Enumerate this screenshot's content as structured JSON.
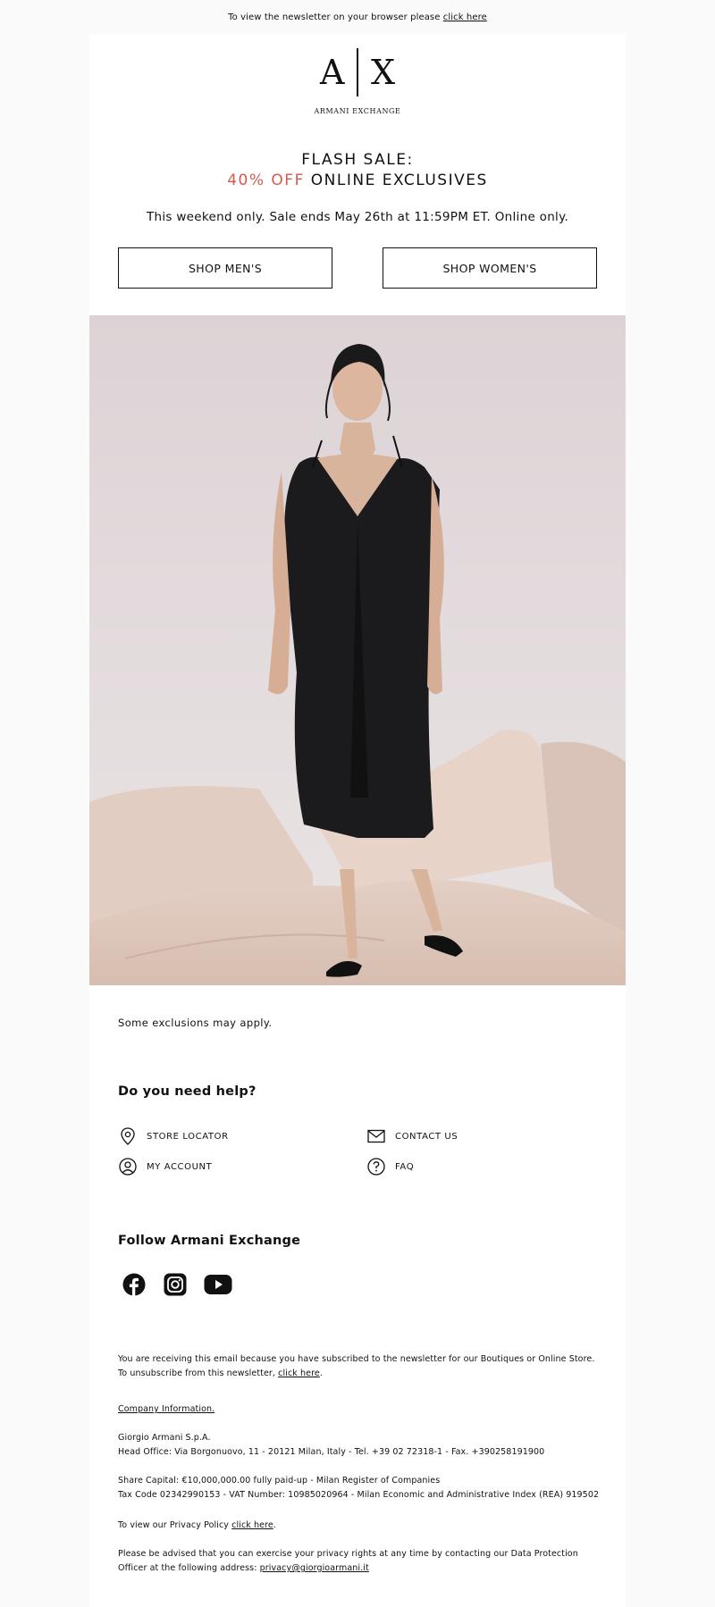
{
  "topbar": {
    "text": "To view the newsletter on your browser please ",
    "link": "click here"
  },
  "logo": {
    "left_letter": "A",
    "right_letter": "X",
    "name": "ARMANI EXCHANGE"
  },
  "headline": {
    "line1": "FLASH SALE:",
    "highlight": "40% OFF",
    "line2_rest": " ONLINE EXCLUSIVES"
  },
  "subline": "This weekend only. Sale ends May 26th at 11:59PM ET. Online only.",
  "buttons": {
    "men": "SHOP MEN'S",
    "women": "SHOP WOMEN'S"
  },
  "exclusions": "Some exclusions may apply.",
  "help": {
    "title": "Do you need help?",
    "items": [
      {
        "label": "STORE LOCATOR",
        "icon": "location-pin-icon"
      },
      {
        "label": "CONTACT US",
        "icon": "mail-icon"
      },
      {
        "label": "MY ACCOUNT",
        "icon": "user-icon"
      },
      {
        "label": "FAQ",
        "icon": "question-icon"
      }
    ]
  },
  "follow": {
    "title": "Follow Armani Exchange",
    "icons": [
      "facebook-icon",
      "instagram-icon",
      "youtube-icon"
    ]
  },
  "legal": {
    "subscribe_text": "You are receiving this email because you have subscribed to the newsletter for our Boutiques or Online Store.",
    "unsubscribe_text": "To unsubscribe from this newsletter, ",
    "unsubscribe_link": "click here",
    "company_info_link": "Company Information.",
    "company_name": "Giorgio Armani S.p.A.",
    "head_office": "Head Office: Via Borgonuovo, 11 - 20121 Milan, Italy - Tel. +39 02 72318-1 - Fax. +390258191900",
    "share_capital": "Share Capital: €10,000,000.00 fully paid-up - Milan Register of Companies",
    "tax_code": "Tax Code 02342990153 - VAT Number: 10985020964 - Milan Economic and Administrative Index (REA) 919502",
    "privacy_text": "To view our Privacy Policy ",
    "privacy_link": "click here",
    "rights_text": "Please be advised that you can exercise your privacy rights at any time by contacting our Data Protection Officer at the following address: ",
    "rights_email": "privacy@giorgioarmani.it"
  },
  "colors": {
    "accent": "#d25a4e",
    "page_bg": "#fafafa",
    "card_bg": "#ffffff"
  }
}
